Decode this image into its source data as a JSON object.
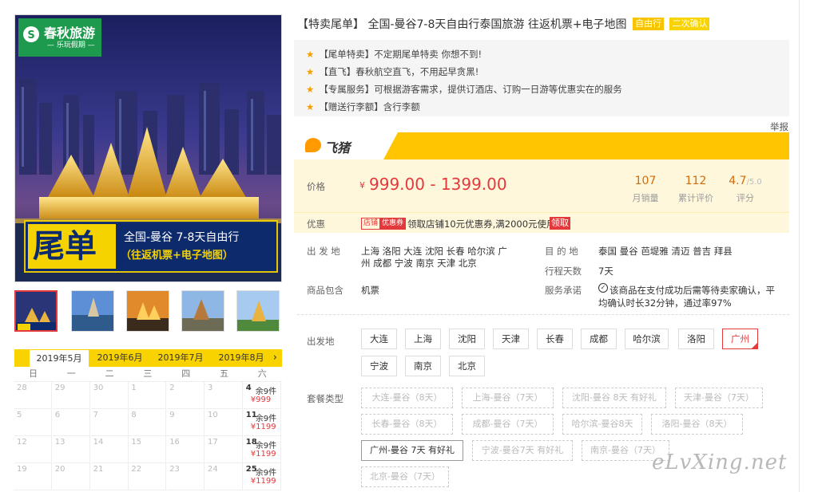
{
  "hero": {
    "logo_name": "春秋旅游",
    "logo_sub": "— 乐玩假期 —",
    "banner_big": "尾单",
    "banner_line1": "全国-曼谷 7-8天自由行",
    "banner_line2": "（往返机票+电子地图）"
  },
  "calendar": {
    "tabs": [
      "2019年5月",
      "2019年6月",
      "2019年7月",
      "2019年8月"
    ],
    "active_tab": 0,
    "next": "›",
    "weekdays": [
      "日",
      "一",
      "二",
      "三",
      "四",
      "五",
      "六"
    ],
    "rows": [
      [
        {
          "d": "28"
        },
        {
          "d": "29"
        },
        {
          "d": "30"
        },
        {
          "d": "1"
        },
        {
          "d": "2"
        },
        {
          "d": "3"
        },
        {
          "d": "4",
          "stock": "余9件",
          "price": "¥999"
        }
      ],
      [
        {
          "d": "5"
        },
        {
          "d": "6"
        },
        {
          "d": "7"
        },
        {
          "d": "8"
        },
        {
          "d": "9"
        },
        {
          "d": "10"
        },
        {
          "d": "11",
          "stock": "余9件",
          "price": "¥1199"
        }
      ],
      [
        {
          "d": "12"
        },
        {
          "d": "13"
        },
        {
          "d": "14"
        },
        {
          "d": "15"
        },
        {
          "d": "16"
        },
        {
          "d": "17"
        },
        {
          "d": "18",
          "stock": "余9件",
          "price": "¥1199"
        }
      ],
      [
        {
          "d": "19"
        },
        {
          "d": "20"
        },
        {
          "d": "21"
        },
        {
          "d": "22"
        },
        {
          "d": "23"
        },
        {
          "d": "24"
        },
        {
          "d": "25",
          "stock": "余9件",
          "price": "¥1199"
        }
      ]
    ]
  },
  "product": {
    "title": "【特卖尾单】 全国-曼谷7-8天自由行泰国旅游 往返机票+电子地图",
    "tag1": "自由行",
    "tag2": "二次确认",
    "highlights": [
      "【尾单特卖】不定期尾单特卖  你想不到!",
      "【直飞】春秋航空直飞，不用起早贪黑!",
      "【专属服务】可根据游客需求，提供订酒店、订购一日游等优惠实在的服务",
      "【赠送行李额】含行李额"
    ],
    "report": "举报",
    "platform": "飞猪",
    "price_label": "价格",
    "price_currency": "¥",
    "price": "999.00 - 1399.00",
    "stats": [
      {
        "num": "107",
        "label": "月销量"
      },
      {
        "num": "112",
        "label": "累计评价"
      },
      {
        "num": "4.7",
        "suffix": "/5.0",
        "label": "评分"
      }
    ],
    "coupon_label": "优惠",
    "coupon_tag1": "店铺",
    "coupon_tag2": "优惠券",
    "coupon_text": "领取店铺10元优惠券,满2000元使用",
    "coupon_get": "领取",
    "depart_label": "出 发 地",
    "depart_line1": "上海  洛阳  大连  沈阳  长春  哈尔滨  广",
    "depart_line2": "州  成都  宁波  南京  天津  北京",
    "dest_label": "目 的 地",
    "dest_value": "泰国  曼谷  芭堤雅  清迈  普吉  拜县",
    "days_label": "行程天数",
    "days_value": "7天",
    "include_label": "商品包含",
    "include_value": "机票",
    "promise_label": "服务承诺",
    "promise_line1": "该商品在支付成功后需等待卖家确认，平",
    "promise_line2": "均确认时长32分钟，通过率97%"
  },
  "options": {
    "origin_label": "出发地",
    "origins": [
      "大连",
      "上海",
      "沈阳",
      "天津",
      "长春",
      "成都",
      "哈尔滨",
      "洛阳",
      "广州",
      "宁波",
      "南京",
      "北京"
    ],
    "selected_origin": "广州",
    "package_label": "套餐类型",
    "packages": [
      "大连-曼谷（8天）",
      "上海-曼谷（7天）",
      "沈阳-曼谷 8天 有好礼",
      "天津-曼谷（7天）",
      "长春-曼谷（8天）",
      "成都-曼谷（7天）",
      "哈尔滨-曼谷8天",
      "洛阳-曼谷（8天）",
      "广州-曼谷 7天 有好礼",
      "宁波-曼谷7天 有好礼",
      "南京-曼谷（7天）",
      "北京-曼谷（7天）"
    ],
    "selected_package": "广州-曼谷 7天 有好礼"
  },
  "watermark": "eLvXing.net",
  "colors": {
    "accent_red": "#e4393c",
    "yellow": "#f8d300",
    "price_orange": "#e4393c",
    "fliggy_yellow": "#ffc500"
  }
}
